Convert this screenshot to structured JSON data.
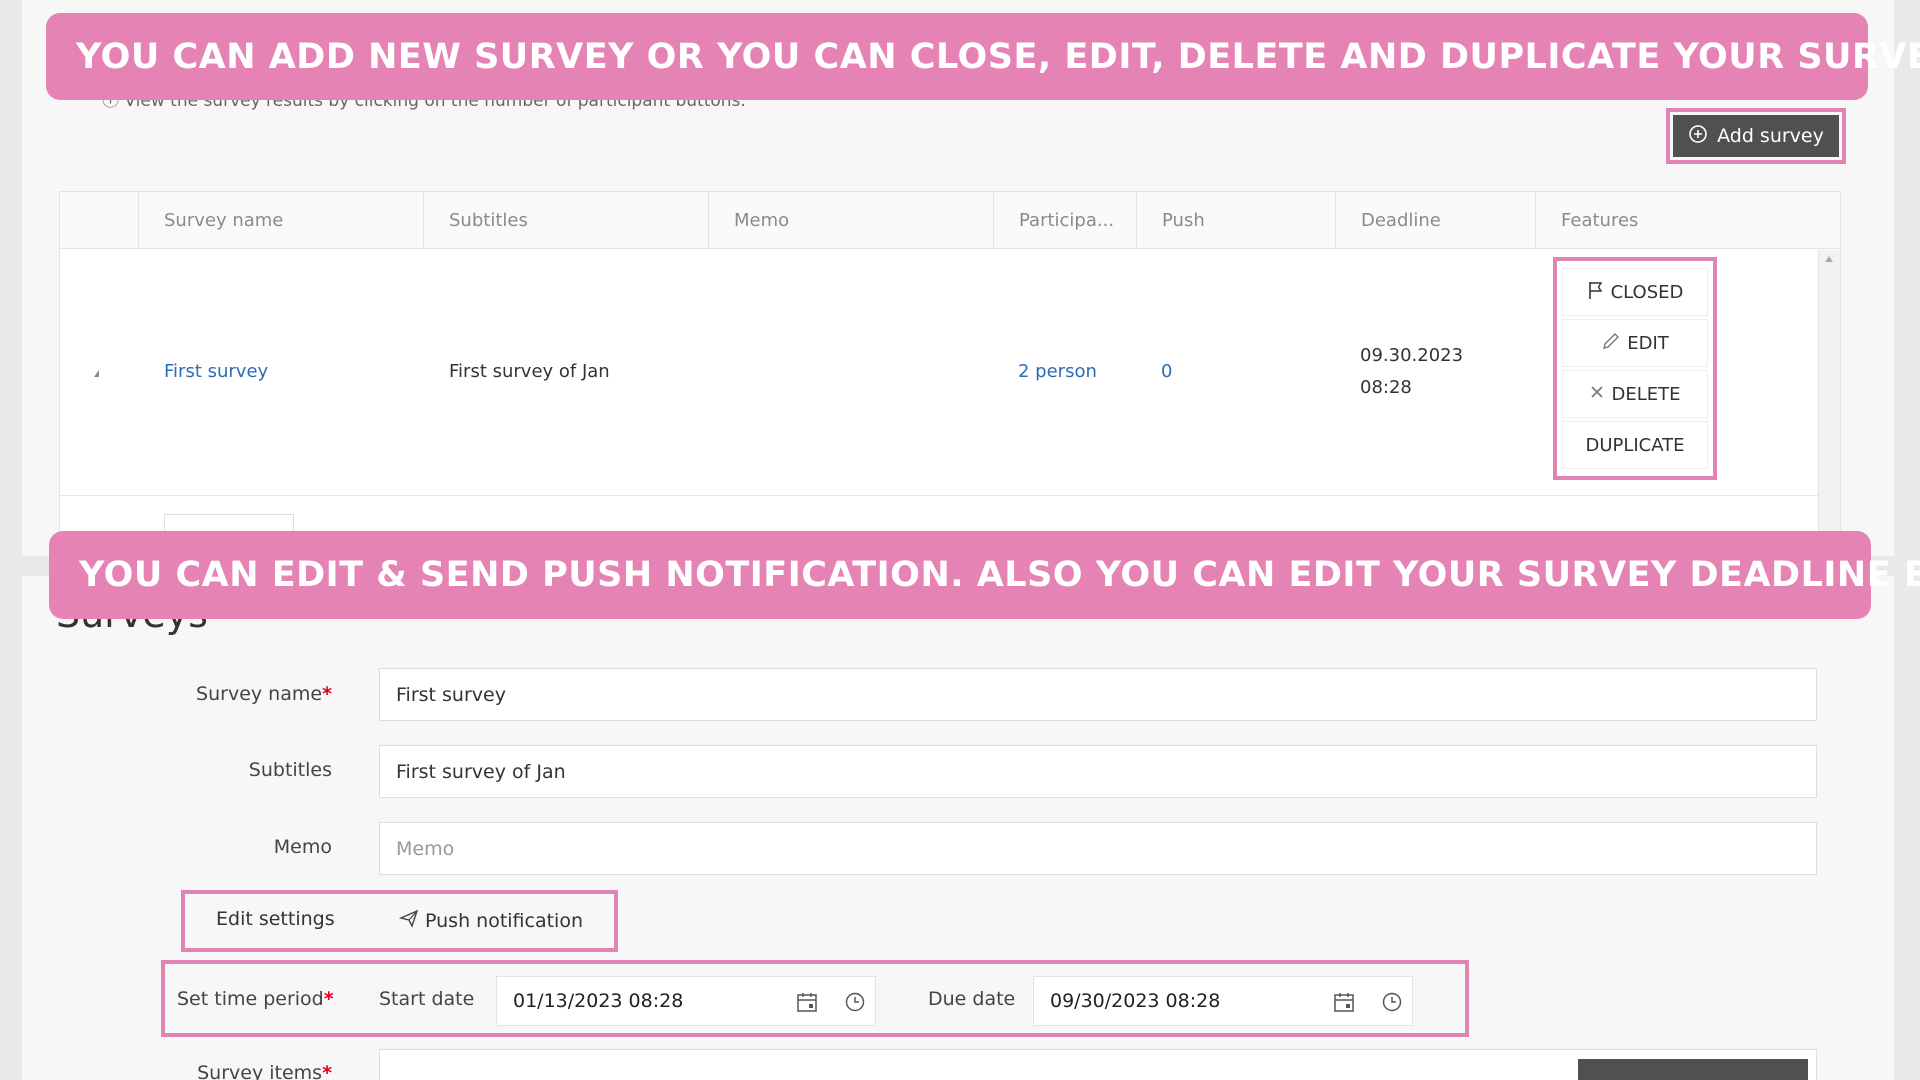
{
  "banners": {
    "top": "YOU CAN ADD NEW SURVEY OR YOU CAN CLOSE, EDIT, DELETE AND DUPLICATE YOUR SURVEY.",
    "middle": "YOU CAN EDIT & SEND PUSH NOTIFICATION. ALSO YOU CAN EDIT YOUR SURVEY DEADLINE ETC."
  },
  "list": {
    "hint": "ⓘ View the survey results by clicking on the number of participant buttons.",
    "add_survey_label": "Add survey",
    "columns": [
      "Survey name",
      "Subtitles",
      "Memo",
      "Participa...",
      "Push",
      "Deadline",
      "Features"
    ],
    "rows": [
      {
        "survey_name": "First survey",
        "subtitles": "First survey of Jan",
        "memo": "",
        "participants": "2 person",
        "push": "0",
        "deadline_date": "09.30.2023",
        "deadline_time": "08:28"
      }
    ],
    "features": {
      "closed": "CLOSED",
      "edit": "EDIT",
      "delete": "DELETE",
      "duplicate": "DUPLICATE"
    }
  },
  "form": {
    "heading": "Surveys",
    "survey_name_label": "Survey name",
    "survey_name_value": "First survey",
    "subtitles_label": "Subtitles",
    "subtitles_value": "First survey of Jan",
    "memo_label": "Memo",
    "memo_placeholder": "Memo",
    "required_mark": "*",
    "tabs": {
      "edit_settings": "Edit settings",
      "push_notification": "Push notification"
    },
    "period": {
      "label": "Set time period",
      "start_label": "Start date",
      "start_value": "01/13/2023 08:28",
      "due_label": "Due date",
      "due_value": "09/30/2023 08:28"
    },
    "survey_items_label": "Survey items"
  },
  "colors": {
    "banner": "#e584b4",
    "highlight_frame": "#e284b3",
    "link": "#2a6db5",
    "required": "#e0001a",
    "dark_button": "#505050"
  }
}
